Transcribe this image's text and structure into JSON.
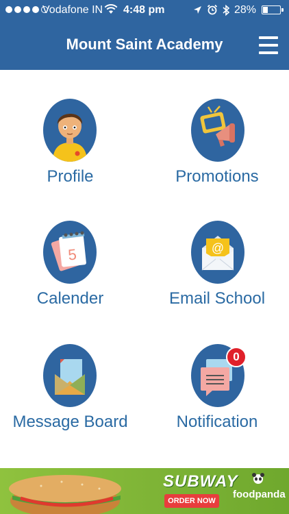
{
  "status_bar": {
    "carrier": "Vodafone IN",
    "time": "4:48 pm",
    "battery_percent": "28%",
    "battery_level": 0.28,
    "signal_bars_filled": 4,
    "signal_bars_total": 5,
    "icons": [
      "wifi-icon",
      "location-arrow-icon",
      "alarm-icon",
      "bluetooth-icon",
      "battery-icon"
    ]
  },
  "header": {
    "title": "Mount Saint Academy",
    "menu_icon": "hamburger-icon"
  },
  "colors": {
    "primary": "#2f65a0",
    "label_text": "#2a6aa3",
    "badge": "#e0202a"
  },
  "menu": [
    {
      "id": "profile",
      "label": "Profile",
      "icon": "student-avatar-icon"
    },
    {
      "id": "promotions",
      "label": "Promotions",
      "icon": "tv-megaphone-icon"
    },
    {
      "id": "calender",
      "label": "Calender",
      "icon": "calendar-icon",
      "calendar_day": "5"
    },
    {
      "id": "email",
      "label": "Email School",
      "icon": "email-envelope-icon",
      "symbol": "@"
    },
    {
      "id": "message_board",
      "label": "Message Board",
      "icon": "envelope-letter-icon"
    },
    {
      "id": "notification",
      "label": "Notification",
      "icon": "chat-bubbles-icon",
      "badge": "0"
    }
  ],
  "ad_banner": {
    "brand": "SUBWAY",
    "cta": "ORDER NOW",
    "partner": "foodpanda"
  }
}
